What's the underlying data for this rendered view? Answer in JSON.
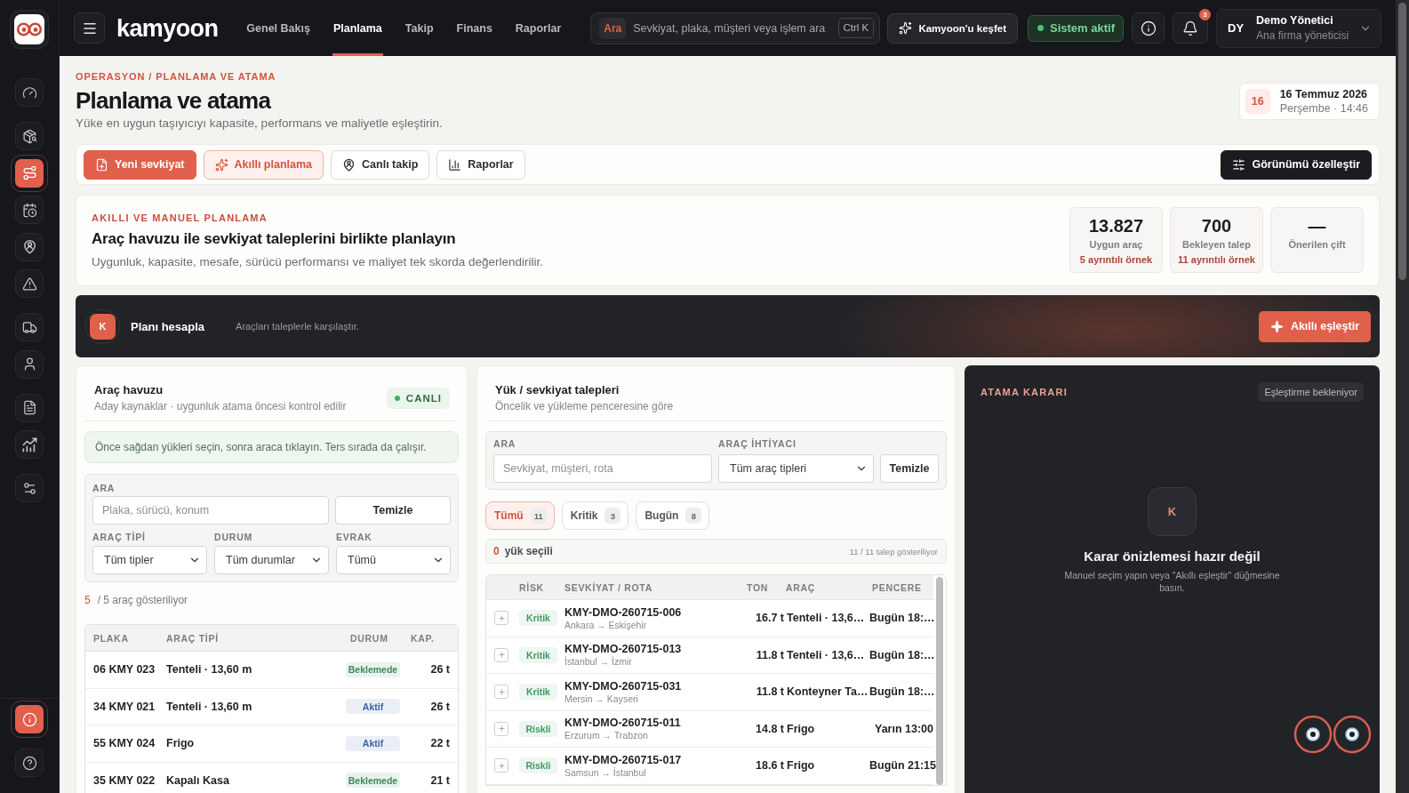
{
  "sidebar": {
    "groups": [
      {
        "items": [
          {
            "selected": false
          }
        ]
      },
      {
        "items": [
          {
            "selected": false
          },
          {
            "selected": true
          },
          {
            "selected": false
          },
          {
            "selected": false
          },
          {
            "selected": false
          }
        ]
      },
      {
        "items": [
          {
            "selected": false
          },
          {
            "selected": false
          }
        ]
      },
      {
        "items": [
          {
            "selected": false
          },
          {
            "selected": false
          }
        ]
      },
      {
        "items": [
          {
            "selected": false
          }
        ]
      }
    ],
    "bottom_items": [
      {
        "highlighted": true
      },
      {
        "highlighted": false
      }
    ]
  },
  "topbar": {
    "brand": "kamyoon",
    "nav": [
      {
        "label": "Genel Bakış",
        "selected": false
      },
      {
        "label": "Planlama",
        "selected": true
      },
      {
        "label": "Takip",
        "selected": false
      },
      {
        "label": "Finans",
        "selected": false
      },
      {
        "label": "Raporlar",
        "selected": false
      }
    ],
    "search": {
      "tag": "Ara",
      "placeholder": "Sevkiyat, plaka, müşteri veya işlem ara",
      "shortcut": "Ctrl K"
    },
    "discover_button": "Kamyoon'u keşfet",
    "status": {
      "label": "Sistem aktif",
      "on": true
    },
    "notifications": {
      "count": "3"
    },
    "user": {
      "initials": "DY",
      "name": "Demo Yönetici",
      "role": "Ana firma yöneticisi"
    }
  },
  "header": {
    "breadcrumb": "OPERASYON / PLANLAMA VE ATAMA",
    "title": "Planlama ve atama",
    "subtitle": "Yüke en uygun taşıyıcıyı kapasite, performans ve maliyetle eşleştirin.",
    "date": {
      "day": "16",
      "date": "16 Temmuz 2026",
      "detail": "Perşembe · 14:46"
    }
  },
  "actions": [
    {
      "label": "Yeni sevkiyat",
      "kind": "primary"
    },
    {
      "label": "Akıllı planlama",
      "kind": "soft"
    },
    {
      "label": "Canlı takip",
      "kind": "outline"
    },
    {
      "label": "Raporlar",
      "kind": "outline"
    }
  ],
  "customize_button": "Görünümü özelleştir",
  "planning_intro": {
    "kicker": "AKILLI VE MANUEL PLANLAMA",
    "title": "Araç havuzu ile sevkiyat taleplerini birlikte planlayın",
    "description": "Uygunluk, kapasite, mesafe, sürücü performansı ve maliyet tek skorda değerlendirilir.",
    "stats": [
      {
        "value": "13.827",
        "label": "Uygun araç",
        "note": "5 ayrıntılı örnek"
      },
      {
        "value": "700",
        "label": "Bekleyen talep",
        "note": "11 ayrıntılı örnek"
      },
      {
        "value": "—",
        "label": "Önerilen çift"
      }
    ]
  },
  "banner": {
    "avatar": "K",
    "title": "Planı hesapla",
    "hint": "Araçları taleplerle karşılaştır.",
    "button": "Akıllı eşleştir"
  },
  "vehicle_pool": {
    "title": "Araç havuzu",
    "subtitle": "Aday kaynaklar · uygunluk atama öncesi kontrol edilir",
    "live_badge": "CANLI",
    "notice": "Önce sağdan yükleri seçin, sonra araca tıklayın. Ters sırada da çalışır.",
    "filters": {
      "search_label": "ARA",
      "search_placeholder": "Plaka, sürücü, konum",
      "clear_button": "Temizle",
      "selects": [
        {
          "label": "ARAÇ TİPİ",
          "value": "Tüm tipler"
        },
        {
          "label": "DURUM",
          "value": "Tüm durumlar"
        },
        {
          "label": "EVRAK",
          "value": "Tümü"
        }
      ]
    },
    "count": {
      "shown": "5",
      "text": "/ 5 araç gösteriliyor"
    },
    "table": {
      "columns": [
        "PLAKA",
        "ARAÇ TİPİ",
        "DURUM",
        "KAP."
      ],
      "rows": [
        {
          "plate": "06 KMY 023",
          "type": "Tenteli · 13,60 m",
          "status": {
            "label": "Beklemede",
            "color": "#3b8a58"
          },
          "capacity": "26 t"
        },
        {
          "plate": "34 KMY 021",
          "type": "Tenteli · 13,60 m",
          "status": {
            "label": "Aktif",
            "color": "#3c63a3"
          },
          "capacity": "26 t"
        },
        {
          "plate": "55 KMY 024",
          "type": "Frigo",
          "status": {
            "label": "Aktif",
            "color": "#3c63a3"
          },
          "capacity": "22 t"
        },
        {
          "plate": "35 KMY 022",
          "type": "Kapalı Kasa",
          "status": {
            "label": "Beklemede",
            "color": "#3b8a58"
          },
          "capacity": "21 t"
        }
      ]
    }
  },
  "load_requests": {
    "title": "Yük / sevkiyat talepleri",
    "subtitle": "Öncelik ve yükleme penceresine göre",
    "filters": {
      "search_label": "ARA",
      "search_placeholder": "Sevkiyat, müşteri, rota",
      "select_label": "ARAÇ İHTİYACI",
      "select_value": "Tüm araç tipleri",
      "clear_button": "Temizle"
    },
    "tabs": [
      {
        "label": "Tümü",
        "count": "11",
        "selected": true
      },
      {
        "label": "Kritik",
        "count": "3",
        "selected": false
      },
      {
        "label": "Bugün",
        "count": "8",
        "selected": false
      }
    ],
    "selection": {
      "count": "0",
      "label": "yük seçili",
      "summary": "11 / 11 talep gösteriliyor"
    },
    "table": {
      "columns": [
        "RİSK",
        "SEVKİYAT / ROTA",
        "TON",
        "ARAÇ",
        "PENCERE"
      ],
      "rows": [
        {
          "risk": {
            "label": "Kritik",
            "color": "#3f9a5f"
          },
          "id": "KMY-DMO-260715-006",
          "route": "Ankara → Eskişehir",
          "tons": "16.7 t",
          "vehicle": "Tenteli · 13,6…",
          "window": "Bugün 18:…"
        },
        {
          "risk": {
            "label": "Kritik",
            "color": "#3f9a5f"
          },
          "id": "KMY-DMO-260715-013",
          "route": "İstanbul → İzmir",
          "tons": "11.8 t",
          "vehicle": "Tenteli · 13,6…",
          "window": "Bugün 18:…"
        },
        {
          "risk": {
            "label": "Kritik",
            "color": "#3f9a5f"
          },
          "id": "KMY-DMO-260715-031",
          "route": "Mersin → Kayseri",
          "tons": "11.8 t",
          "vehicle": "Konteyner Ta…",
          "window": "Bugün 18:…"
        },
        {
          "risk": {
            "label": "Riskli",
            "color": "#3f9a5f"
          },
          "id": "KMY-DMO-260715-011",
          "route": "Erzurum → Trabzon",
          "tons": "14.8 t",
          "vehicle": "Frigo",
          "window": "Yarın 13:00"
        },
        {
          "risk": {
            "label": "Riskli",
            "color": "#3f9a5f"
          },
          "id": "KMY-DMO-260715-017",
          "route": "Samsun → İstanbul",
          "tons": "18.6 t",
          "vehicle": "Frigo",
          "window": "Bugün 21:15"
        }
      ]
    }
  },
  "decision": {
    "title": "ATAMA KARARI",
    "status": "Eşleştirme bekleniyor",
    "empty": {
      "avatar": "K",
      "title": "Karar önizlemesi hazır değil",
      "description": "Manuel seçim yapın veya \"Akıllı eşleştir\" düğmesine basın."
    }
  }
}
